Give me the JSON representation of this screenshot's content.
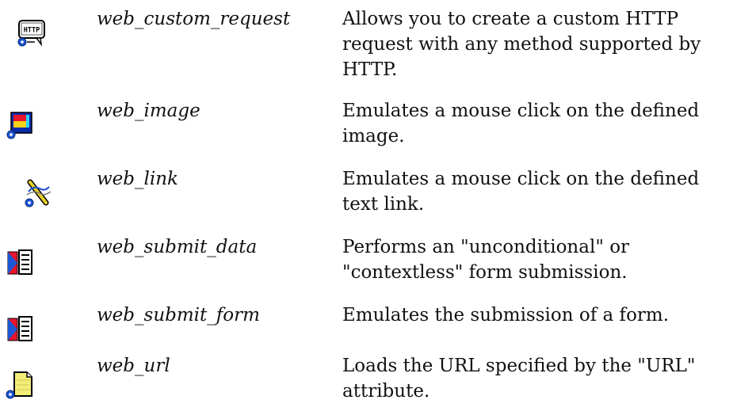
{
  "functions": [
    {
      "icon": "http-request-icon",
      "name": "web_custom_request",
      "description": "Allows you to create a custom HTTP request with any method supported by HTTP."
    },
    {
      "icon": "image-icon",
      "name": "web_image",
      "description": "Emulates a mouse click on the defined image."
    },
    {
      "icon": "link-icon",
      "name": "web_link",
      "description": "Emulates a mouse click on the defined text link."
    },
    {
      "icon": "submit-data-icon",
      "name": "web_submit_data",
      "description": "Performs an \"unconditional\" or \"contextless\" form submission."
    },
    {
      "icon": "submit-form-icon",
      "name": "web_submit_form",
      "description": "Emulates the submission of a form."
    },
    {
      "icon": "url-icon",
      "name": "web_url",
      "description": "Loads the URL specified by the \"URL\" attribute."
    }
  ],
  "icon_badge_text": "HTTP"
}
